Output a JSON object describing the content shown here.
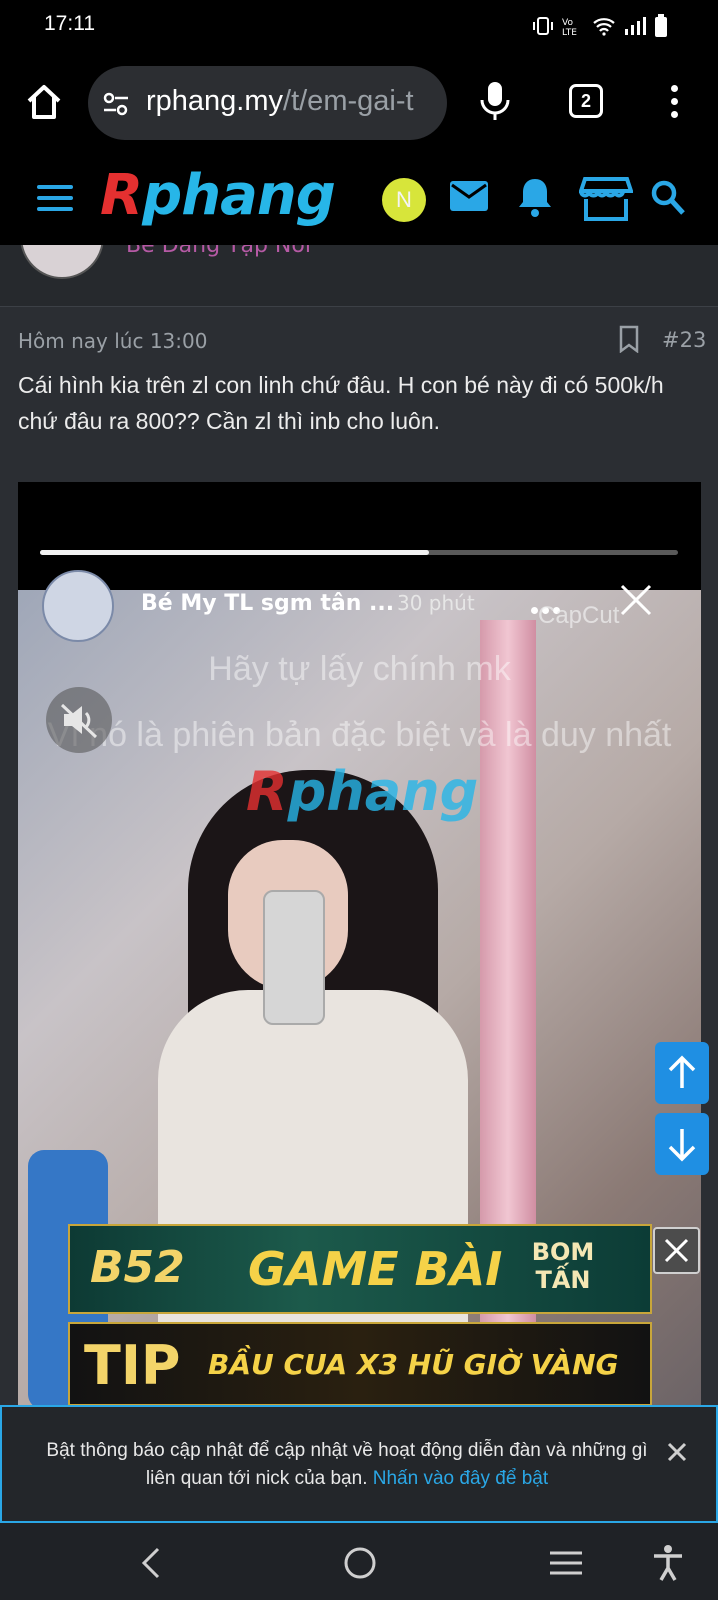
{
  "status_bar": {
    "time": "17:11",
    "icons": [
      "vibrate-icon",
      "volte-icon",
      "wifi-icon",
      "signal-icon",
      "battery-icon"
    ]
  },
  "browser": {
    "url_host": "rphang.my",
    "url_path": "/t/em-gai-t",
    "tab_count": "2"
  },
  "site": {
    "logo_first": "R",
    "logo_rest": "phang",
    "user_initial": "N",
    "colors": {
      "accent": "#2aa7e6",
      "logo_red": "#e53030",
      "logo_blue": "#27b6e8",
      "avatar_bg": "#d7e53a"
    }
  },
  "previous_post": {
    "author_snippet": "Bé Đang Tập Nói"
  },
  "post": {
    "timestamp": "Hôm nay lúc 13:00",
    "number": "#23",
    "body": "Cái hình kia trên zl con linh chứ đâu. H con bé này đi có 500k/h chứ đâu ra 800?? Cần zl thì inb cho luôn."
  },
  "video": {
    "progress": 0.61,
    "story_name": "Bé My TL sgm tân ...",
    "story_time": "30 phút",
    "capcut_label": "CapCut",
    "overlay_line1": "Hãy tự lấy chính mk",
    "overlay_line2": "Vì nó là phiên bản đặc biệt và là duy nhất",
    "watermark_first": "R",
    "watermark_rest": "phang"
  },
  "ads": {
    "ad1_logo": "B52",
    "ad1_main": "GAME BÀI",
    "ad1_side": "BOM TẤN",
    "ad2_logo": "TIP",
    "ad2_text": "BẦU CUA X3 HŨ GIỜ VÀNG"
  },
  "notice": {
    "text": "Bật thông báo cập nhật để cập nhật về hoạt động diễn đàn và những gì liên quan tới nick của bạn.",
    "link": "Nhấn vào đây để bật"
  }
}
